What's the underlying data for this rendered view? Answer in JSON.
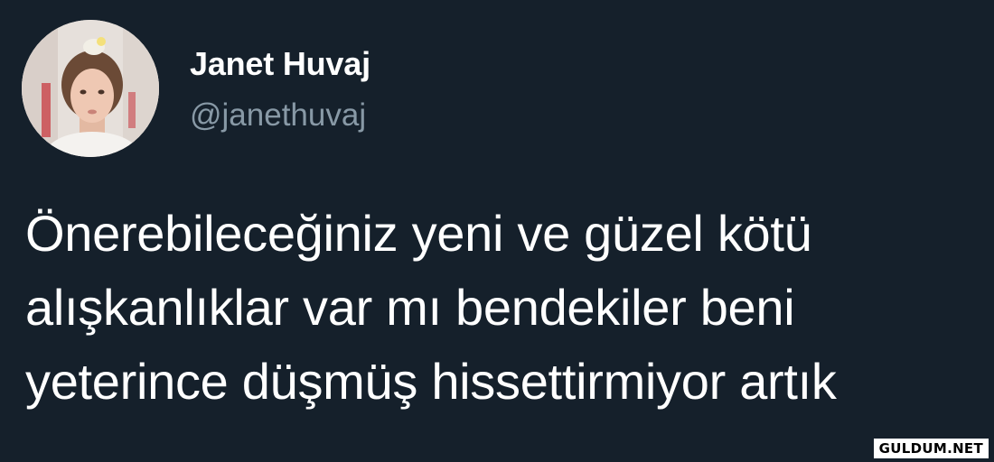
{
  "author": {
    "display_name": "Janet Huvaj",
    "handle": "@janethuvaj"
  },
  "tweet": {
    "lines": [
      "Önerebileceğiniz yeni ve güzel kötü",
      "alışkanlıklar var mı bendekiler beni",
      "yeterince düşmüş hissettirmiyor artık"
    ]
  },
  "watermark": "GULDUM.NET",
  "colors": {
    "background": "#15202b",
    "text": "#ffffff",
    "secondary_text": "#8899a6"
  }
}
